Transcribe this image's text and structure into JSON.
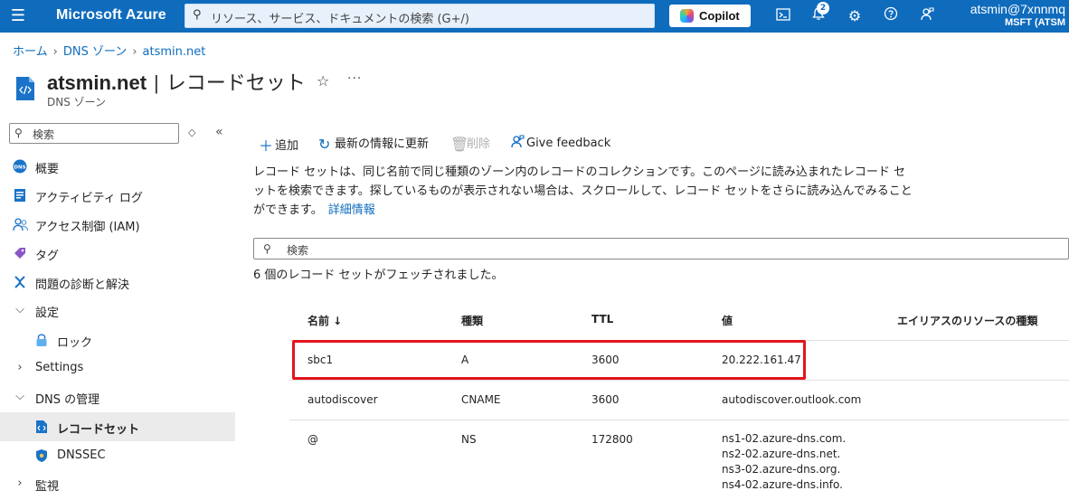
{
  "topbar": {
    "brand": "Microsoft Azure",
    "search_placeholder": "リソース、サービス、ドキュメントの検索 (G+/)",
    "copilot_label": "Copilot",
    "notifications_count": "2",
    "user_name": "atsmin@7xnnmq",
    "user_tenant": "MSFT (ATSM"
  },
  "breadcrumb": [
    "ホーム",
    "DNS ゾーン",
    "atsmin.net"
  ],
  "header": {
    "resource_name": "atsmin.net",
    "separator": "|",
    "page_name": "レコードセット",
    "subtitle": "DNS ゾーン"
  },
  "sidebar": {
    "search_placeholder": "検索",
    "items": [
      {
        "label": "概要",
        "icon": "dns-icon"
      },
      {
        "label": "アクティビティ ログ",
        "icon": "activity-log-icon"
      },
      {
        "label": "アクセス制御 (IAM)",
        "icon": "people-icon"
      },
      {
        "label": "タグ",
        "icon": "tag-icon"
      },
      {
        "label": "問題の診断と解決",
        "icon": "wrench-icon"
      },
      {
        "label": "設定",
        "icon": "chevron-down-icon"
      },
      {
        "label": "ロック",
        "icon": "lock-icon"
      },
      {
        "label": "Settings",
        "icon": "chevron-right-icon"
      },
      {
        "label": "DNS の管理",
        "icon": "chevron-down-icon"
      },
      {
        "label": "レコードセット",
        "icon": "record-set-icon"
      },
      {
        "label": "DNSSEC",
        "icon": "shield-icon"
      },
      {
        "label": "監視",
        "icon": "chevron-right-icon"
      }
    ]
  },
  "toolbar": {
    "add": "追加",
    "refresh": "最新の情報に更新",
    "delete": "削除",
    "feedback": "Give feedback"
  },
  "description": {
    "text": "レコード セットは、同じ名前で同じ種類のゾーン内のレコードのコレクションです。このページに読み込まれたレコード セットを検索できます。探しているものが表示されない場合は、スクロールして、レコード セットをさらに読み込んでみることができます。",
    "link": "詳細情報"
  },
  "main_search_placeholder": "検索",
  "fetch_count": "6 個のレコード セットがフェッチされました。",
  "table": {
    "headers": [
      "名前 ↓",
      "種類",
      "TTL",
      "値",
      "エイリアスのリソースの種類"
    ],
    "rows": [
      {
        "name": "sbc1",
        "type": "A",
        "ttl": "3600",
        "value": [
          "20.222.161.47"
        ]
      },
      {
        "name": "autodiscover",
        "type": "CNAME",
        "ttl": "3600",
        "value": [
          "autodiscover.outlook.com"
        ]
      },
      {
        "name": "@",
        "type": "NS",
        "ttl": "172800",
        "value": [
          "ns1-02.azure-dns.com.",
          "ns2-02.azure-dns.net.",
          "ns3-02.azure-dns.org.",
          "ns4-02.azure-dns.info."
        ]
      }
    ]
  },
  "colors": {
    "azure_blue": "#0f6cbd",
    "highlight_red": "#e3141e"
  }
}
